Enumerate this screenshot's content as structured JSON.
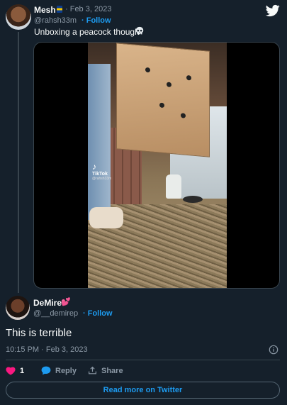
{
  "quoted_tweet": {
    "author_name": "Mesh",
    "date": "· Feb 3, 2023",
    "handle": "@rahsh33m",
    "follow_label": "· Follow",
    "text": "Unboxing a peacock though",
    "emoji_icon": "skull-icon",
    "media": {
      "watermark": "TikTok",
      "watermark_user": "@rahsh33m"
    }
  },
  "tweet": {
    "author_name": "DeMire",
    "name_emoji": "💕",
    "handle": "@__demirep",
    "follow_label": "· Follow",
    "text": "This is terrible",
    "timestamp": "10:15 PM · Feb 3, 2023",
    "actions": {
      "like_count": "1",
      "reply_label": "Reply",
      "share_label": "Share"
    },
    "read_more_label": "Read more on Twitter"
  },
  "colors": {
    "background": "#15202b",
    "accent": "#1d9bf0",
    "like": "#f91880",
    "muted": "#8b98a5"
  }
}
